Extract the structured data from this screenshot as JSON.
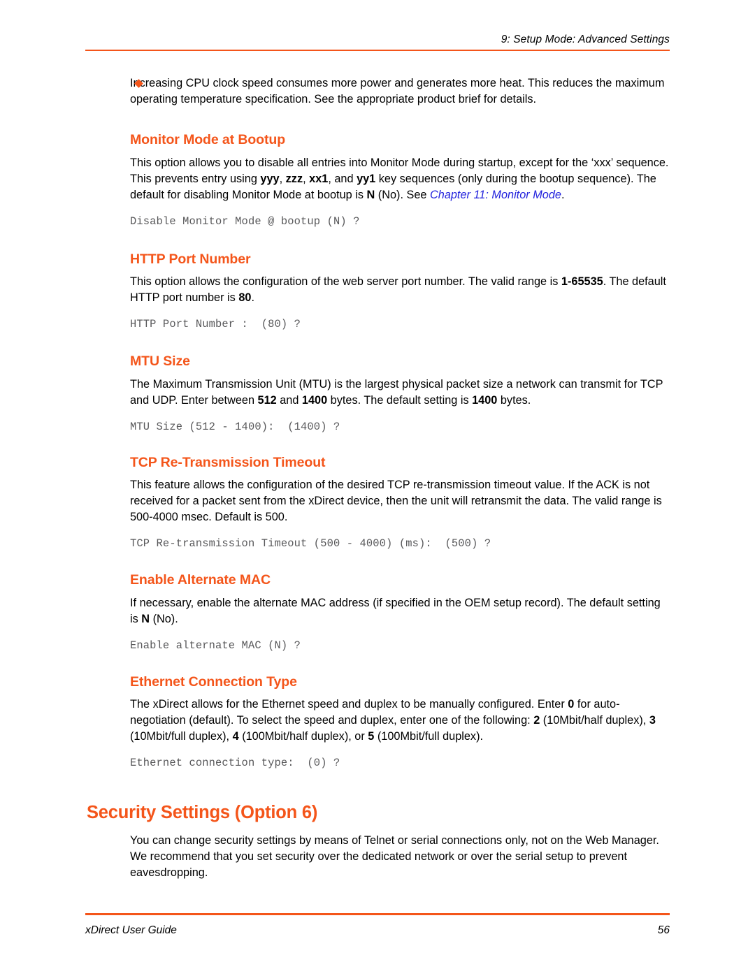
{
  "header": {
    "chapter_title": "9: Setup Mode: Advanced Settings"
  },
  "notes": [
    {
      "bullet_icon": "diamond-bullet-icon",
      "text": "Increasing CPU clock speed consumes more power and generates more heat.  This reduces the maximum operating temperature specification.  See the appropriate product brief for details."
    }
  ],
  "sections": [
    {
      "heading": "Monitor Mode at Bootup",
      "body_parts": {
        "p1_a": "This option allows you to disable all entries into Monitor Mode during startup, except for the ‘xxx’ sequence. This prevents entry using ",
        "b1": "yyy",
        "p1_b": ", ",
        "b2": "zzz",
        "p1_c": ", ",
        "b3": "xx1",
        "p1_d": ", and ",
        "b4": "yy1",
        "p1_e": " key sequences (only during the bootup sequence). The default for disabling Monitor Mode at bootup is ",
        "b5": "N",
        "p1_f": " (No). See ",
        "link": "Chapter 11: Monitor Mode",
        "p1_g": "."
      },
      "cli": "Disable Monitor Mode @ bootup (N) ?"
    },
    {
      "heading": "HTTP Port Number",
      "body_parts": {
        "p1_a": "This option allows the configuration of the web server port number. The valid range is ",
        "b1": "1-65535",
        "p1_b": ". The default HTTP port number is ",
        "b2": "80",
        "p1_c": "."
      },
      "cli": "HTTP Port Number :  (80) ?"
    },
    {
      "heading": "MTU Size",
      "body_parts": {
        "p1_a": "The Maximum Transmission Unit (MTU) is the largest physical packet size a network can transmit for TCP and UDP. Enter between ",
        "b1": "512",
        "p1_b": " and ",
        "b2": "1400",
        "p1_c": " bytes. The default setting is ",
        "b3": "1400",
        "p1_d": " bytes."
      },
      "cli": "MTU Size (512 - 1400):  (1400) ?"
    },
    {
      "heading": "TCP Re-Transmission Timeout",
      "body_parts": {
        "p1_a": "This feature allows the configuration of the desired TCP re-transmission timeout value. If the ACK is not received for a packet sent from the xDirect device, then the unit will retransmit the data. The valid range is 500-4000 msec. Default is 500."
      },
      "cli": "TCP Re-transmission Timeout (500 - 4000) (ms):  (500) ?"
    },
    {
      "heading": "Enable Alternate MAC",
      "body_parts": {
        "p1_a": "If necessary, enable the alternate MAC address (if specified in the OEM setup record). The default setting is ",
        "b1": "N",
        "p1_b": " (No)."
      },
      "cli": "Enable alternate MAC (N) ?"
    },
    {
      "heading": "Ethernet Connection Type",
      "body_parts": {
        "p1_a": "The xDirect allows for the Ethernet speed and duplex to be manually configured. Enter ",
        "b1": "0",
        "p1_b": " for auto-negotiation (default). To select the speed and duplex, enter one of the following: ",
        "b2": "2",
        "p1_c": " (10Mbit/half duplex), ",
        "b3": "3",
        "p1_d": " (10Mbit/full duplex), ",
        "b4": "4",
        "p1_e": " (100Mbit/half duplex), or ",
        "b5": "5",
        "p1_f": " (100Mbit/full duplex)."
      },
      "cli": "Ethernet connection type:  (0) ?"
    }
  ],
  "security_section": {
    "heading": "Security Settings (Option 6)",
    "paragraph": "You can change security settings by means of Telnet or serial connections only, not on the Web Manager. We recommend that you set security over the dedicated network or over the serial setup to prevent eavesdropping."
  },
  "footer": {
    "guide_title": "xDirect User Guide",
    "page_number": "56"
  },
  "colors": {
    "accent_orange": "#F4551A",
    "link_blue": "#2222DD",
    "cli_gray": "#58585a"
  }
}
